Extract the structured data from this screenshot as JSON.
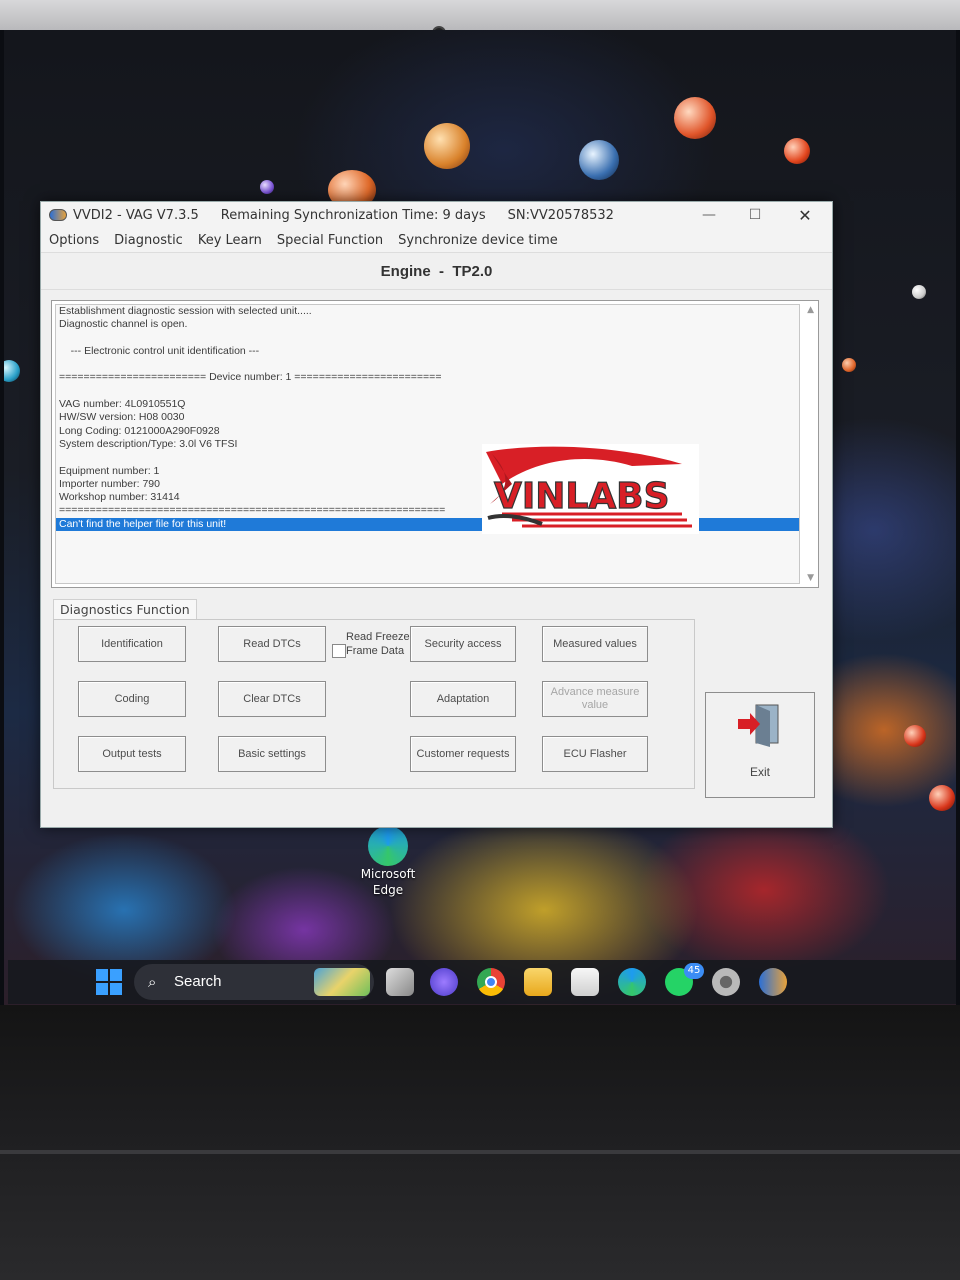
{
  "window": {
    "app_title": "VVDI2 - VAG V7.3.5",
    "sync_text": "Remaining Synchronization Time: 9 days",
    "serial": "SN:VV20578532",
    "minimize": "—",
    "maximize": "☐",
    "close": "✕"
  },
  "menu": [
    "Options",
    "Diagnostic",
    "Key Learn",
    "Special Function",
    "Synchronize device time"
  ],
  "module_header": "Engine  -  TP2.0",
  "log": [
    "Establishment diagnostic session with selected unit.....",
    "Diagnostic channel is open.",
    "",
    "    --- Electronic control unit identification ---",
    "",
    "======================== Device number: 1 ========================",
    "",
    "VAG number: 4L0910551Q",
    "HW/SW version: H08 0030",
    "Long Coding: 0121000A290F0928",
    "System description/Type: 3.0l V6 TFSI",
    "",
    "Equipment number: 1",
    "Importer number: 790",
    "Workshop number: 31414",
    "===============================================================",
    "Can't find the helper file for this unit!"
  ],
  "log_selected_index": 16,
  "watermark_text": "VINLABS",
  "diagnostics": {
    "group_label": "Diagnostics Function",
    "buttons": {
      "identification": "Identification",
      "read_dtcs": "Read DTCs",
      "security_access": "Security access",
      "measured_values": "Measured values",
      "coding": "Coding",
      "clear_dtcs": "Clear DTCs",
      "adaptation": "Adaptation",
      "advance_measure": "Advance measure value",
      "output_tests": "Output tests",
      "basic_settings": "Basic settings",
      "customer_requests": "Customer requests",
      "ecu_flasher": "ECU Flasher"
    },
    "freeze_frame_checkbox": {
      "label": "Read Freeze Frame Data",
      "checked": false
    },
    "exit_label": "Exit"
  },
  "desktop_icon_label": "Microsoft Edge",
  "taskbar": {
    "search_label": "Search",
    "whatsapp_badge": "45",
    "icons": [
      "windows-start-icon",
      "weather-widget-icon",
      "task-view-icon",
      "teams-chat-icon",
      "chrome-icon",
      "file-explorer-icon",
      "microsoft-store-icon",
      "edge-icon",
      "whatsapp-icon",
      "settings-icon",
      "vvdi2-app-icon"
    ]
  },
  "colors": {
    "selection": "#1f7ad8",
    "window_bg": "#f0f0f0",
    "watermark_red": "#d81f26"
  }
}
